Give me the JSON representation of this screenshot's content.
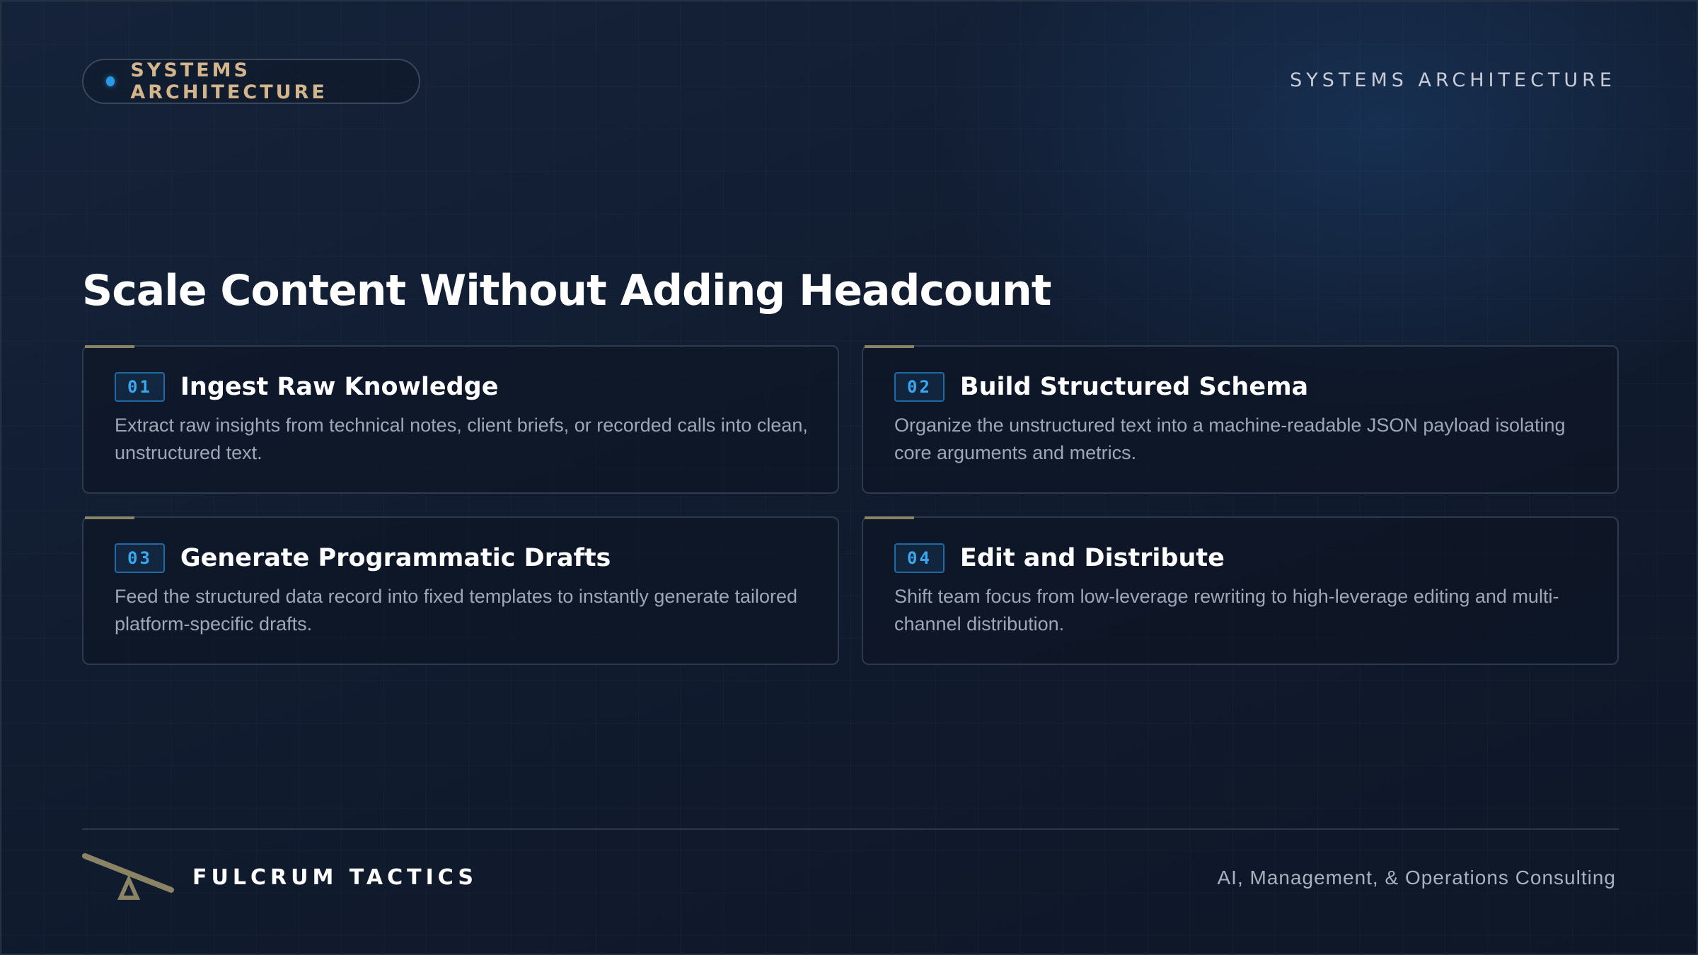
{
  "header": {
    "pill_label": "SYSTEMS ARCHITECTURE",
    "top_right_label": "SYSTEMS ARCHITECTURE"
  },
  "title": "Scale Content Without Adding Headcount",
  "cards": [
    {
      "number": "01",
      "title": "Ingest Raw Knowledge",
      "description": "Extract raw insights from technical notes, client briefs, or recorded calls into clean, unstructured text."
    },
    {
      "number": "02",
      "title": "Build Structured Schema",
      "description": "Organize the unstructured text into a machine-readable JSON payload isolating core arguments and metrics."
    },
    {
      "number": "03",
      "title": "Generate Programmatic Drafts",
      "description": "Feed the structured data record into fixed templates to instantly generate tailored platform-specific drafts."
    },
    {
      "number": "04",
      "title": "Edit and Distribute",
      "description": "Shift team focus from low-leverage rewriting to high-leverage editing and multi-channel distribution."
    }
  ],
  "footer": {
    "brand": "FULCRUM TACTICS",
    "tagline": "AI, Management, & Operations Consulting",
    "logo_icon": "fulcrum-seesaw-icon"
  },
  "colors": {
    "accent_blue": "#2b9ae6",
    "accent_gold": "#d3b58c",
    "logo_olive": "#8a8464",
    "background": "#111c30"
  }
}
